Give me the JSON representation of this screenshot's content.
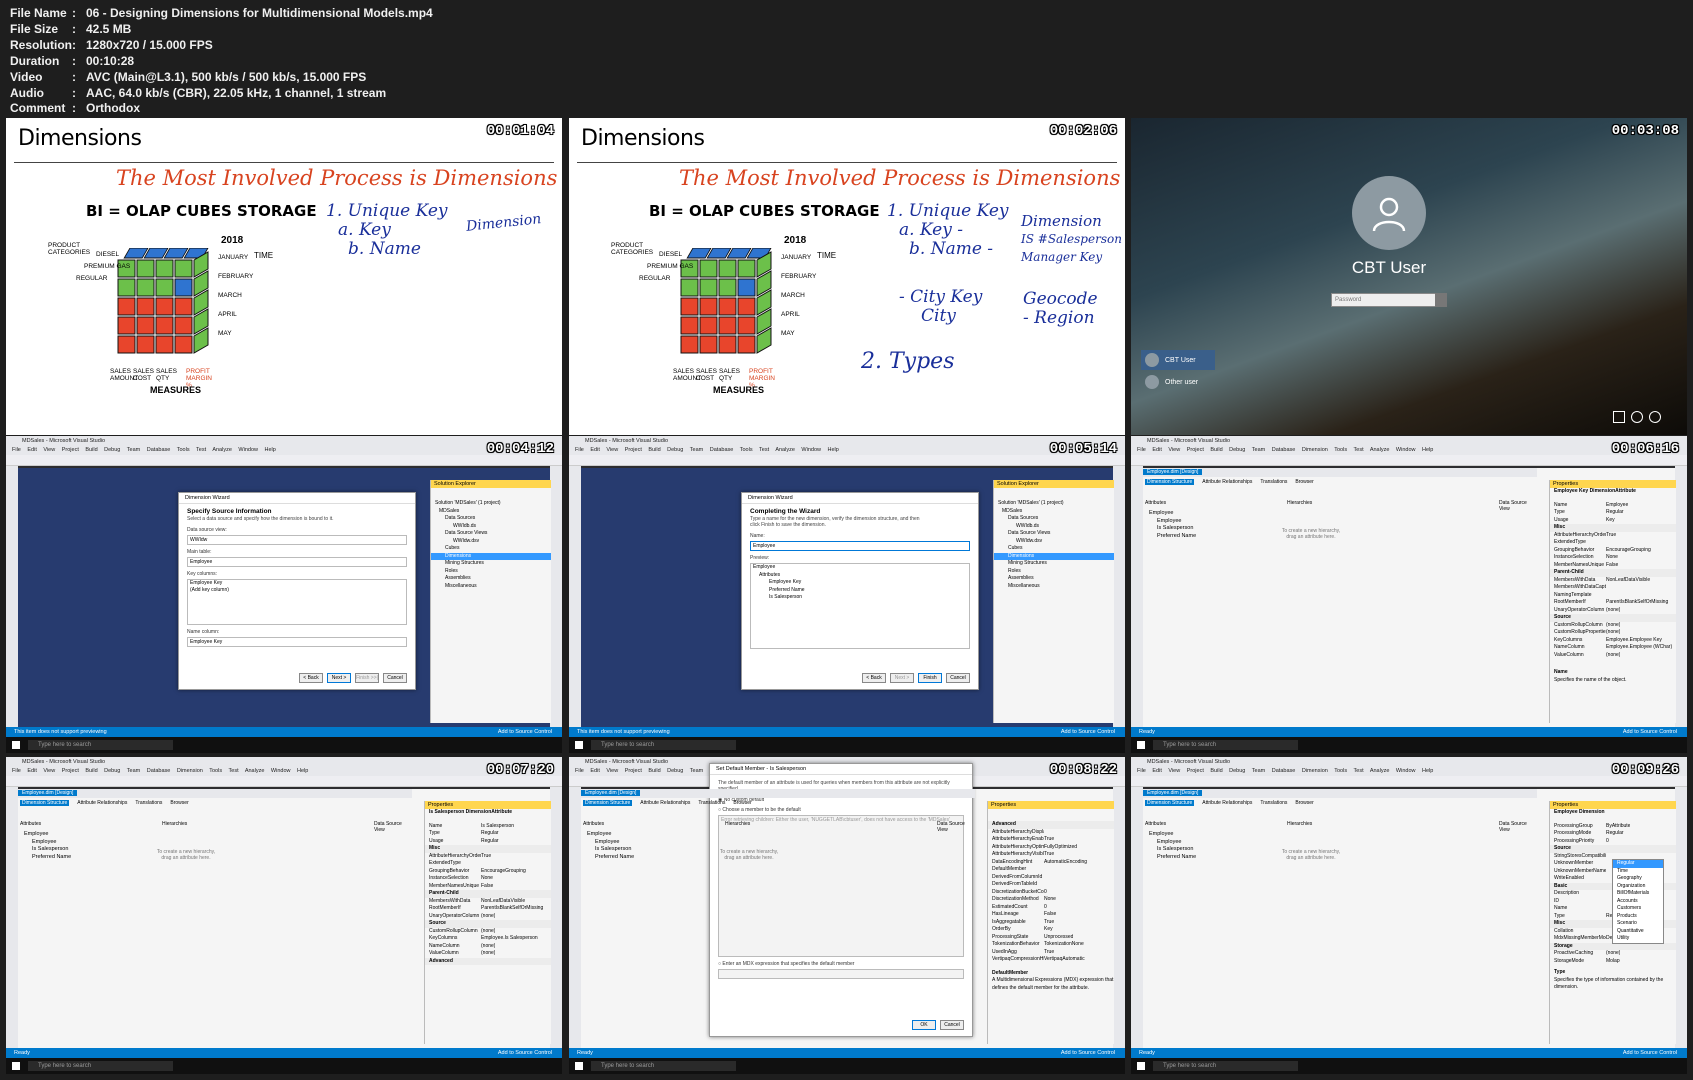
{
  "media_info": [
    {
      "key": "File Name",
      "value": "06 - Designing Dimensions for Multidimensional Models.mp4"
    },
    {
      "key": "File Size",
      "value": "42.5 MB"
    },
    {
      "key": "Resolution",
      "value": "1280x720 / 15.000 FPS"
    },
    {
      "key": "Duration",
      "value": "00:10:28"
    },
    {
      "key": "Video",
      "value": "AVC (Main@L3.1), 500 kb/s / 500 kb/s, 15.000 FPS"
    },
    {
      "key": "Audio",
      "value": "AAC, 64.0 kb/s (CBR), 22.05 kHz, 1 channel, 1 stream"
    },
    {
      "key": "Comment",
      "value": "Orthodox"
    }
  ],
  "separator": ":",
  "thumbnails": {
    "t1": {
      "timestamp": "00:01:04"
    },
    "t2": {
      "timestamp": "00:02:06"
    },
    "t3": {
      "timestamp": "00:03:08"
    },
    "t4": {
      "timestamp": "00:04:12"
    },
    "t5": {
      "timestamp": "00:05:14"
    },
    "t6": {
      "timestamp": "00:06:16"
    },
    "t7": {
      "timestamp": "00:07:20"
    },
    "t8": {
      "timestamp": "00:08:22"
    },
    "t9": {
      "timestamp": "00:09:26"
    }
  },
  "whiteboard": {
    "title": "Dimensions",
    "headline": "The Most Involved Process is Dimensions",
    "subheading": "BI = OLAP CUBES STORAGE",
    "year": "2018",
    "time_label": "TIME",
    "measures_label": "MEASURES",
    "product_label": "PRODUCT CATEGORIES",
    "categories": [
      "DIESEL",
      "PREMIUM GAS",
      "REGULAR"
    ],
    "months": [
      "JANUARY",
      "FEBRUARY",
      "MARCH",
      "APRIL",
      "MAY"
    ],
    "measures": [
      "SALES AMOUNT",
      "SALES COST",
      "SALES QTY",
      "PROFIT MARGIN %"
    ],
    "notes_1": [
      "1. Unique Key",
      "a. Key",
      "b. Name"
    ],
    "dim_note_1": "Dimension",
    "notes_2_keys": [
      "1. Unique Key",
      "a. Key -",
      "b. Name -"
    ],
    "notes_2_dim": [
      "Dimension",
      "IS #Salesperson",
      "Manager Key"
    ],
    "notes_2_city": [
      "- City Key",
      "City"
    ],
    "notes_2_geo": [
      "Geocode",
      "- Region"
    ],
    "notes_2_types": "2. Types"
  },
  "login": {
    "user_name": "CBT User",
    "password_placeholder": "Password",
    "tile_user": "CBT User",
    "tile_other": "Other user"
  },
  "vs": {
    "title": "MDSales - Microsoft Visual Studio",
    "menu": "File Edit View Project Build Debug Team Database Tools Test Analyze Window Help",
    "menu_dim": "File Edit View Project Build Debug Team Database Dimension Tools Test Analyze Window Help",
    "status_preview": "This item does not support previewing",
    "status_ready": "Ready",
    "taskbar_search": "Type here to search",
    "add_source": "Add to Source Control",
    "solution_explorer": "Solution Explorer",
    "solution_items": [
      "Solution 'MDSales' (1 project)",
      "MDSales",
      "Data Sources",
      "WWIdb.ds",
      "Data Source Views",
      "WWIdw.dsv",
      "Cubes",
      "Dimensions",
      "Mining Structures",
      "Roles",
      "Assemblies",
      "Miscellaneous"
    ],
    "wizard_title": "Dimension Wizard",
    "wizard_step": "Specify Source Information",
    "wizard_desc": "Select a data source and specify how the dimension is bound to it.",
    "dsv_label": "Data source view:",
    "dsv_value": "WWIdw",
    "main_table_label": "Main table:",
    "main_table_value": "Employee",
    "key_columns_label": "Key columns:",
    "key_columns_values": [
      "Employee Key",
      "(Add key column)"
    ],
    "name_column_label": "Name column:",
    "name_column_value": "Employee Key",
    "buttons": [
      "< Back",
      "Next >",
      "Finish >>|",
      "Cancel"
    ],
    "complete_step": "Completing the Wizard",
    "complete_desc": "Type a name for the new dimension, verify the dimension structure, and then click Finish to save the dimension.",
    "name_label": "Name:",
    "name_value": "Employee",
    "preview_label": "Preview:",
    "preview_items": [
      "Employee",
      "Attributes",
      "Employee Key",
      "Preferred Name",
      "Is Salesperson"
    ],
    "complete_buttons": [
      "< Back",
      "Next >",
      "Finish",
      "Cancel"
    ],
    "design_tab": "Employee.dim [Design]",
    "design_tabs": [
      "Dimension Structure",
      "Attribute Relationships",
      "Translations",
      "Browser"
    ],
    "attributes_header": "Attributes",
    "hierarchies_header": "Hierarchies",
    "dsv_header": "Data Source View",
    "hier_hint": "To create a new hierarchy, drag an attribute here.",
    "attr_items": [
      "Employee",
      "Employee",
      "Is Salesperson",
      "Preferred Name"
    ],
    "properties_title": "Properties",
    "props_6_header": "Employee Key  DimensionAttribute",
    "props_6": [
      [
        "Name",
        "Employee"
      ],
      [
        "Type",
        "Regular"
      ],
      [
        "Usage",
        "Key"
      ],
      [
        "Misc",
        ""
      ],
      [
        "AttributeHierarchyOrdered",
        "True"
      ],
      [
        "ExtendedType",
        ""
      ],
      [
        "GroupingBehavior",
        "EncourageGrouping"
      ],
      [
        "InstanceSelection",
        "None"
      ],
      [
        "MemberNamesUnique",
        "False"
      ],
      [
        "Parent-Child",
        ""
      ],
      [
        "MembersWithData",
        "NonLeafDataVisible"
      ],
      [
        "MembersWithDataCaption",
        ""
      ],
      [
        "NamingTemplate",
        ""
      ],
      [
        "RootMemberIf",
        "ParentIsBlankSelfOrMissing"
      ],
      [
        "UnaryOperatorColumn",
        "(none)"
      ],
      [
        "Source",
        ""
      ],
      [
        "CustomRollupColumn",
        "(none)"
      ],
      [
        "CustomRollupProperties",
        "(none)"
      ],
      [
        "KeyColumns",
        "Employee.Employee Key"
      ],
      [
        "NameColumn",
        "Employee.Employee (WChar)"
      ],
      [
        "ValueColumn",
        "(none)"
      ]
    ],
    "props_6_footer_title": "Name",
    "props_6_footer": "Specifies the name of the object.",
    "props_7_header": "Is Salesperson  DimensionAttribute",
    "props_7": [
      [
        "Name",
        "Is Salesperson"
      ],
      [
        "Type",
        "Regular"
      ],
      [
        "Usage",
        "Regular"
      ],
      [
        "Misc",
        ""
      ],
      [
        "AttributeHierarchyOrdered",
        "True"
      ],
      [
        "ExtendedType",
        ""
      ],
      [
        "GroupingBehavior",
        "EncourageGrouping"
      ],
      [
        "InstanceSelection",
        "None"
      ],
      [
        "MemberNamesUnique",
        "False"
      ],
      [
        "Parent-Child",
        ""
      ],
      [
        "MembersWithData",
        "NonLeafDataVisible"
      ],
      [
        "RootMemberIf",
        "ParentIsBlankSelfOrMissing"
      ],
      [
        "UnaryOperatorColumn",
        "(none)"
      ],
      [
        "Source",
        ""
      ],
      [
        "CustomRollupColumn",
        "(none)"
      ],
      [
        "KeyColumns",
        "Employee.Is Salesperson"
      ],
      [
        "NameColumn",
        "(none)"
      ],
      [
        "ValueColumn",
        "(none)"
      ],
      [
        "Advanced",
        ""
      ]
    ],
    "default_member_title": "Set Default Member - Is Salesperson",
    "default_member_desc": "The default member of an attribute is used for queries when members from this attribute are not explicitly specified.",
    "default_options": [
      "No custom default",
      "Choose a member to be the default",
      "Enter an MDX expression that specifies the default member"
    ],
    "default_error": "Error retrieving children: Either the user, 'NUGGETLAB\\cbtuser', does not have access to the 'MDSales'",
    "default_buttons": [
      "OK",
      "Cancel"
    ],
    "props_8": [
      [
        "Advanced",
        ""
      ],
      [
        "AttributeHierarchyDisplayFolder",
        ""
      ],
      [
        "AttributeHierarchyEnabled",
        "True"
      ],
      [
        "AttributeHierarchyOptimizedState",
        "FullyOptimized"
      ],
      [
        "AttributeHierarchyVisible",
        "True"
      ],
      [
        "DataEncodingHint",
        "AutomaticEncoding"
      ],
      [
        "DefaultMember",
        ""
      ],
      [
        "DerivedFromColumnId",
        ""
      ],
      [
        "DerivedFromTableId",
        ""
      ],
      [
        "DiscretizationBucketCount",
        "0"
      ],
      [
        "DiscretizationMethod",
        "None"
      ],
      [
        "EstimatedCount",
        "0"
      ],
      [
        "HasLineage",
        "False"
      ],
      [
        "IsAggregatable",
        "True"
      ],
      [
        "OrderBy",
        "Key"
      ],
      [
        "ProcessingState",
        "Unprocessed"
      ],
      [
        "TokenizationBehavior",
        "TokenizationNone"
      ],
      [
        "UsedInAgg",
        "True"
      ],
      [
        "VertipaqCompressionHint",
        "VertipaqAutomatic"
      ]
    ],
    "props_8_footer_title": "DefaultMember",
    "props_8_footer": "A Multidimensional Expressions (MDX) expression that defines the default member for the attribute.",
    "props_9_header": "Employee  Dimension",
    "props_9": [
      [
        "ProcessingGroup",
        "ByAttribute"
      ],
      [
        "ProcessingMode",
        "Regular"
      ],
      [
        "ProcessingPriority",
        "0"
      ],
      [
        "Source",
        ""
      ],
      [
        "StringStoresCompatibility",
        ""
      ],
      [
        "UnknownMember",
        ""
      ],
      [
        "UnknownMemberName",
        ""
      ],
      [
        "WriteEnabled",
        ""
      ],
      [
        "Basic",
        ""
      ],
      [
        "Description",
        ""
      ],
      [
        "ID",
        ""
      ],
      [
        "Name",
        ""
      ],
      [
        "Type",
        "Regular"
      ],
      [
        "Misc",
        ""
      ],
      [
        "Collation",
        ""
      ],
      [
        "MdxMissingMemberMode",
        "Default"
      ],
      [
        "Storage",
        ""
      ],
      [
        "ProactiveCaching",
        "(none)"
      ],
      [
        "StorageMode",
        "Molap"
      ]
    ],
    "type_options": [
      "Regular",
      "Time",
      "Geography",
      "Organization",
      "BillOfMaterials",
      "Accounts",
      "Customers",
      "Products",
      "Scenario",
      "Quantitative",
      "Utility"
    ],
    "props_9_footer_title": "Type",
    "props_9_footer": "Specifies the type of information contained by the dimension."
  }
}
